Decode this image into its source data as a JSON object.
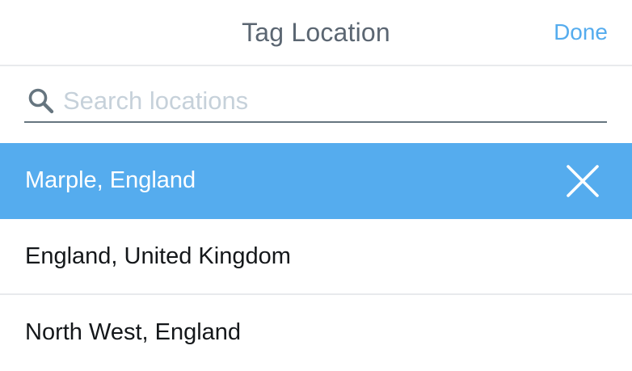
{
  "header": {
    "title": "Tag Location",
    "done_label": "Done"
  },
  "search": {
    "placeholder": "Search locations",
    "value": "",
    "icon": "search-icon"
  },
  "locations": {
    "selected": {
      "label": "Marple, England",
      "clear_icon": "close-icon"
    },
    "items": [
      {
        "label": "England, United Kingdom"
      },
      {
        "label": "North West, England"
      }
    ]
  },
  "colors": {
    "accent": "#55acee",
    "title_text": "#5b6672",
    "body_text": "#14171a",
    "placeholder": "#c6d1da",
    "divider": "#e8eaed"
  }
}
